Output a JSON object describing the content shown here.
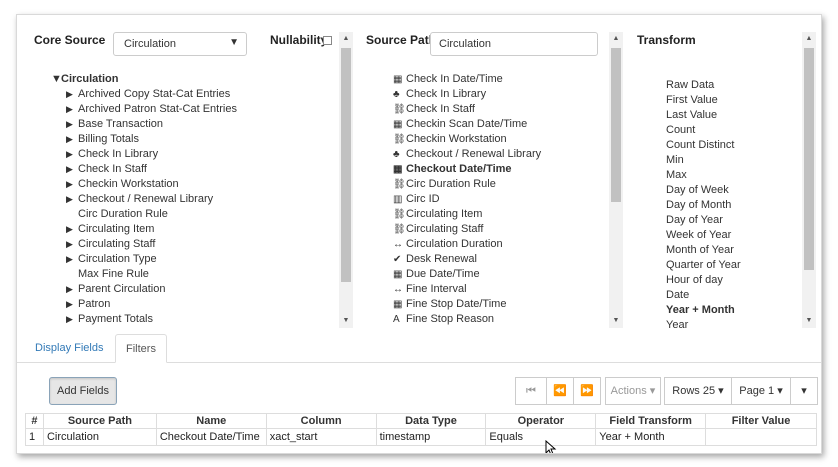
{
  "core_source": {
    "label": "Core Source",
    "selected": "Circulation"
  },
  "nullability": {
    "label": "Nullability"
  },
  "source_path": {
    "label": "Source Path",
    "value": "Circulation"
  },
  "transform": {
    "label": "Transform"
  },
  "tree": {
    "root": "Circulation",
    "items": [
      {
        "label": "Archived Copy Stat-Cat Entries",
        "expandable": true
      },
      {
        "label": "Archived Patron Stat-Cat Entries",
        "expandable": true
      },
      {
        "label": "Base Transaction",
        "expandable": true
      },
      {
        "label": "Billing Totals",
        "expandable": true
      },
      {
        "label": "Check In Library",
        "expandable": true
      },
      {
        "label": "Check In Staff",
        "expandable": true
      },
      {
        "label": "Checkin Workstation",
        "expandable": true
      },
      {
        "label": "Checkout / Renewal Library",
        "expandable": true
      },
      {
        "label": "Circ Duration Rule",
        "expandable": false
      },
      {
        "label": "Circulating Item",
        "expandable": true
      },
      {
        "label": "Circulating Staff",
        "expandable": true
      },
      {
        "label": "Circulation Type",
        "expandable": true
      },
      {
        "label": "Max Fine Rule",
        "expandable": false
      },
      {
        "label": "Parent Circulation",
        "expandable": true
      },
      {
        "label": "Patron",
        "expandable": true
      },
      {
        "label": "Payment Totals",
        "expandable": true
      }
    ]
  },
  "source_fields": [
    {
      "label": "Check In Date/Time",
      "icon": "calendar-icon",
      "bold": false
    },
    {
      "label": "Check In Library",
      "icon": "tree-icon",
      "bold": false
    },
    {
      "label": "Check In Staff",
      "icon": "link-icon",
      "bold": false
    },
    {
      "label": "Checkin Scan Date/Time",
      "icon": "calendar-icon",
      "bold": false
    },
    {
      "label": "Checkin Workstation",
      "icon": "link-icon",
      "bold": false
    },
    {
      "label": "Checkout / Renewal Library",
      "icon": "tree-icon",
      "bold": false
    },
    {
      "label": "Checkout Date/Time",
      "icon": "calendar-icon",
      "bold": true
    },
    {
      "label": "Circ Duration Rule",
      "icon": "link-icon",
      "bold": false
    },
    {
      "label": "Circ ID",
      "icon": "barcode-icon",
      "bold": false
    },
    {
      "label": "Circulating Item",
      "icon": "link-icon",
      "bold": false
    },
    {
      "label": "Circulating Staff",
      "icon": "link-icon",
      "bold": false
    },
    {
      "label": "Circulation Duration",
      "icon": "interval-icon",
      "bold": false
    },
    {
      "label": "Desk Renewal",
      "icon": "check-circle-icon",
      "bold": false
    },
    {
      "label": "Due Date/Time",
      "icon": "calendar-icon",
      "bold": false
    },
    {
      "label": "Fine Interval",
      "icon": "interval-icon",
      "bold": false
    },
    {
      "label": "Fine Stop Date/Time",
      "icon": "calendar-icon",
      "bold": false
    },
    {
      "label": "Fine Stop Reason",
      "icon": "text-icon",
      "bold": false
    }
  ],
  "transforms": [
    {
      "label": "Raw Data",
      "bold": false
    },
    {
      "label": "First Value",
      "bold": false
    },
    {
      "label": "Last Value",
      "bold": false
    },
    {
      "label": "Count",
      "bold": false
    },
    {
      "label": "Count Distinct",
      "bold": false
    },
    {
      "label": "Min",
      "bold": false
    },
    {
      "label": "Max",
      "bold": false
    },
    {
      "label": "Day of Week",
      "bold": false
    },
    {
      "label": "Day of Month",
      "bold": false
    },
    {
      "label": "Day of Year",
      "bold": false
    },
    {
      "label": "Week of Year",
      "bold": false
    },
    {
      "label": "Month of Year",
      "bold": false
    },
    {
      "label": "Quarter of Year",
      "bold": false
    },
    {
      "label": "Hour of day",
      "bold": false
    },
    {
      "label": "Date",
      "bold": false
    },
    {
      "label": "Year + Month",
      "bold": true
    },
    {
      "label": "Year",
      "bold": false
    }
  ],
  "tabs": {
    "display_fields": "Display Fields",
    "filters": "Filters"
  },
  "toolbar": {
    "add_fields": "Add Fields",
    "actions": "Actions",
    "rows": "Rows 25",
    "page": "Page 1"
  },
  "grid": {
    "headers": [
      "#",
      "Source Path",
      "Name",
      "Column",
      "Data Type",
      "Operator",
      "Field Transform",
      "Filter Value"
    ],
    "rows": [
      [
        "1",
        "Circulation",
        "Checkout Date/Time",
        "xact_start",
        "timestamp",
        "Equals",
        "Year + Month",
        ""
      ]
    ]
  }
}
